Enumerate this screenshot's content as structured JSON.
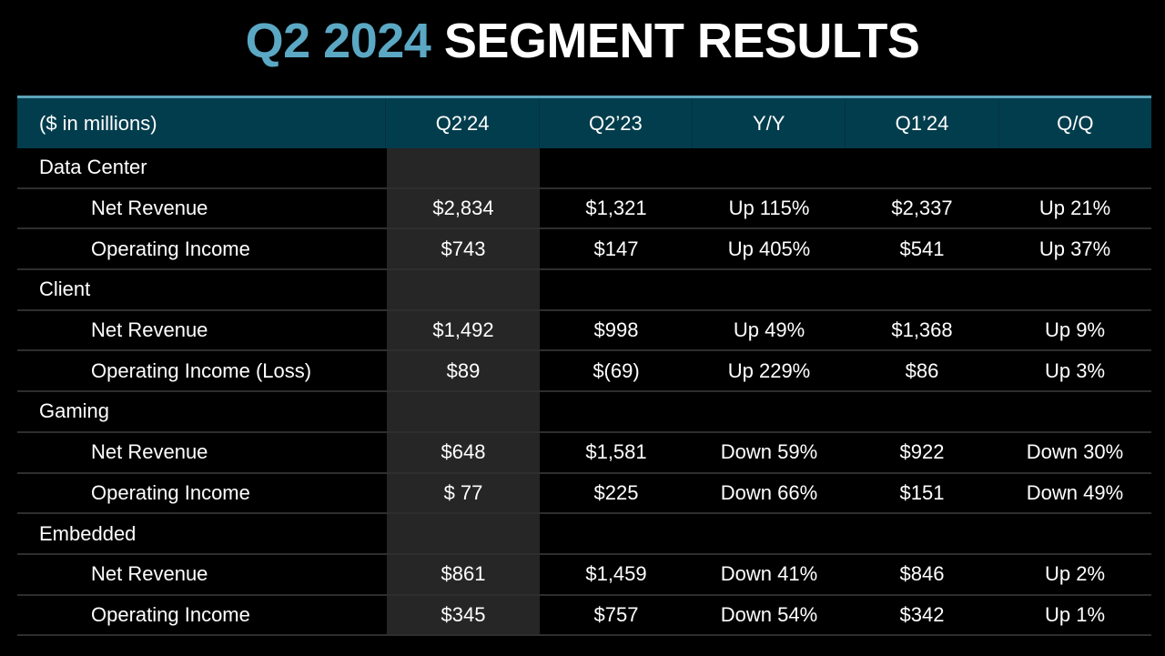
{
  "title": {
    "accent": "Q2 2024",
    "main": "SEGMENT RESULTS"
  },
  "colors": {
    "accent": "#5ba8c4",
    "header_bg": "#023d4d",
    "highlight_col": "#262626"
  },
  "table": {
    "columns": [
      "($ in millions)",
      "Q2’24",
      "Q2’23",
      "Y/Y",
      "Q1’24",
      "Q/Q"
    ],
    "rows": [
      {
        "type": "segment",
        "label": "Data Center",
        "cells": [
          "",
          "",
          "",
          "",
          ""
        ]
      },
      {
        "type": "sub",
        "label": "Net Revenue",
        "cells": [
          "$2,834",
          "$1,321",
          "Up 115%",
          "$2,337",
          "Up 21%"
        ]
      },
      {
        "type": "sub",
        "label": "Operating Income",
        "cells": [
          "$743",
          "$147",
          "Up 405%",
          "$541",
          "Up 37%"
        ]
      },
      {
        "type": "segment",
        "label": "Client",
        "cells": [
          "",
          "",
          "",
          "",
          ""
        ]
      },
      {
        "type": "sub",
        "label": "Net Revenue",
        "cells": [
          "$1,492",
          "$998",
          "Up 49%",
          "$1,368",
          "Up 9%"
        ]
      },
      {
        "type": "sub",
        "label": "Operating Income (Loss)",
        "cells": [
          "$89",
          "$(69)",
          "Up 229%",
          "$86",
          "Up 3%"
        ]
      },
      {
        "type": "segment",
        "label": "Gaming",
        "cells": [
          "",
          "",
          "",
          "",
          ""
        ]
      },
      {
        "type": "sub",
        "label": "Net Revenue",
        "cells": [
          "$648",
          "$1,581",
          "Down 59%",
          "$922",
          "Down 30%"
        ]
      },
      {
        "type": "sub",
        "label": "Operating Income",
        "cells": [
          "$ 77",
          "$225",
          "Down 66%",
          "$151",
          "Down 49%"
        ]
      },
      {
        "type": "segment",
        "label": "Embedded",
        "cells": [
          "",
          "",
          "",
          "",
          ""
        ]
      },
      {
        "type": "sub",
        "label": "Net Revenue",
        "cells": [
          "$861",
          "$1,459",
          "Down 41%",
          "$846",
          "Up 2%"
        ]
      },
      {
        "type": "sub",
        "label": "Operating Income",
        "cells": [
          "$345",
          "$757",
          "Down 54%",
          "$342",
          "Up 1%"
        ]
      }
    ]
  }
}
